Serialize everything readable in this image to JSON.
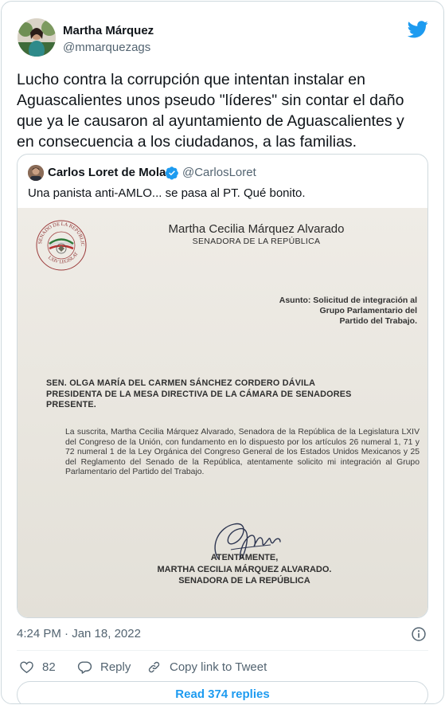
{
  "tweet": {
    "author_name": "Martha Márquez",
    "author_handle": "@mmarquezags",
    "text": "Lucho contra la corrupción que intentan instalar en\nAguascalientes unos pseudo \"líderes\" sin contar el daño\nque ya le causaron al ayuntamiento de Aguascalientes y\nen consecuencia a los ciudadanos, a las familias.",
    "timestamp": "4:24 PM · Jan 18, 2022",
    "logo_icon": "twitter-bird-icon",
    "accent_color": "#1d9bf0"
  },
  "quote": {
    "author_name": "Carlos Loret de Mola",
    "author_handle": "@CarlosLoret",
    "verified_icon": "verified-badge-icon",
    "text": "Una panista anti-AMLO... se pasa al PT. Qué bonito.",
    "document": {
      "seal_top_text": "SENADO DE LA REPÚBLICA",
      "seal_bottom_text": "LXIV LEGISLATURA",
      "sender_name": "Martha Cecilia Márquez Alvarado",
      "sender_title": "SENADORA DE LA REPÚBLICA",
      "subject": "Asunto: Solicitud de integración al\nGrupo Parlamentario del\nPartido del Trabajo.",
      "recipient": "SEN. OLGA MARÍA DEL CARMEN SÁNCHEZ CORDERO DÁVILA\nPRESIDENTA DE LA MESA DIRECTIVA DE LA CÁMARA DE SENADORES\nPRESENTE.",
      "body": "La suscrita, Martha Cecilia Márquez Alvarado, Senadora de la República de la Legislatura LXIV del Congreso de la Unión, con fundamento en lo dispuesto por los artículos 26 numeral 1, 71 y 72 numeral 1 de la Ley Orgánica del Congreso General de los Estados Unidos Mexicanos y 25 del Reglamento del Senado de la República, atentamente solicito mi integración al Grupo Parlamentario del Partido del Trabajo.",
      "closing": "ATENTAMENTE,",
      "signer_name": "MARTHA CECILIA MÁRQUEZ ALVARADO.",
      "signer_title": "SENADORA DE LA REPÚBLICA"
    }
  },
  "actions": {
    "like_icon": "heart-icon",
    "like_count": "82",
    "reply_icon": "reply-bubble-icon",
    "reply_label": "Reply",
    "copy_icon": "link-icon",
    "copy_label": "Copy link to Tweet",
    "info_icon": "info-icon"
  },
  "read_replies_label": "Read 374 replies"
}
